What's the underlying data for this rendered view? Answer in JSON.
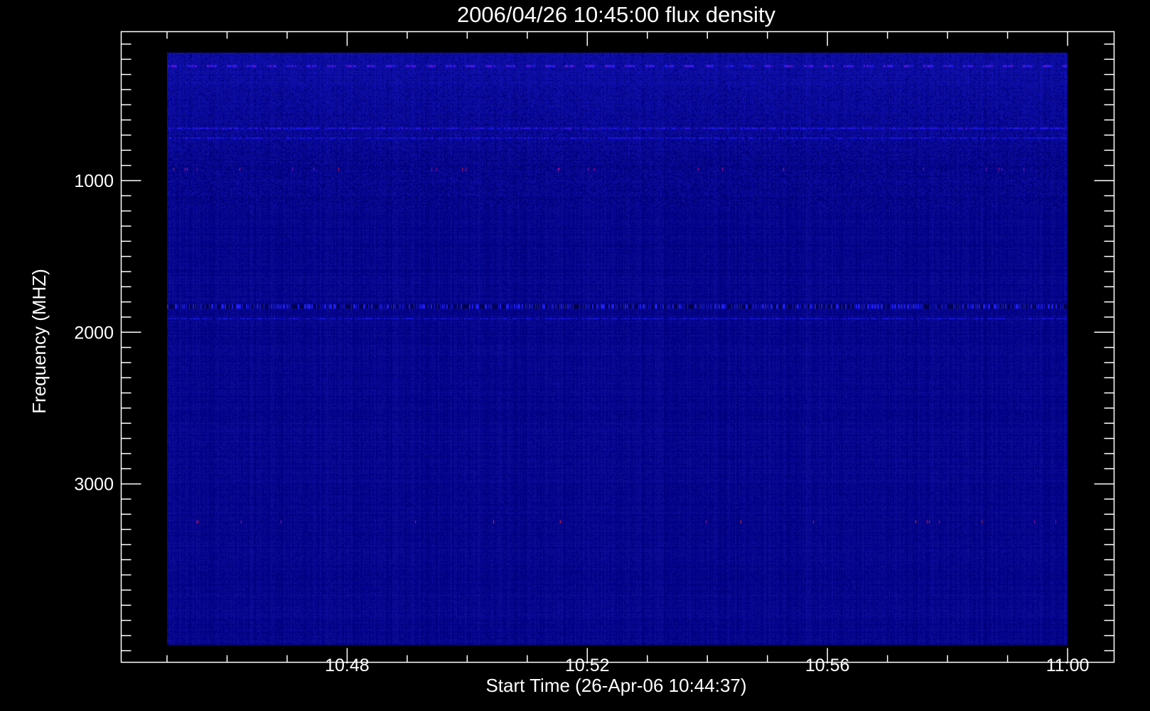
{
  "chart_data": {
    "type": "heatmap",
    "title": "2006/04/26 10:45:00 flux density",
    "xlabel": "Start Time (26-Apr-06 10:44:37)",
    "ylabel": "Frequency (MHZ)",
    "x_unit": "minutes after 10:45:00",
    "x_range": [
      0,
      15
    ],
    "x_major_ticks": [
      {
        "value": 3,
        "label": "10:48"
      },
      {
        "value": 7,
        "label": "10:52"
      },
      {
        "value": 11,
        "label": "10:56"
      },
      {
        "value": 15,
        "label": "11:00"
      }
    ],
    "x_minor_step": 1,
    "y_axis_range": [
      40,
      4180
    ],
    "y_data_range": [
      150,
      4070
    ],
    "y_inverted": true,
    "y_major_ticks": [
      {
        "value": 1000,
        "label": "1000"
      },
      {
        "value": 2000,
        "label": "2000"
      },
      {
        "value": 3000,
        "label": "3000"
      }
    ],
    "y_minor_step": 100,
    "colormap": [
      "#000000",
      "#0a0a8c",
      "#2020ff",
      "#8020c0",
      "#ff2020",
      "#ffa020"
    ],
    "background_level": 0.3,
    "features": [
      {
        "freq_mhz": 245,
        "kind": "dotted",
        "level": 0.6
      },
      {
        "freq_mhz": 655,
        "kind": "line",
        "level": 0.55
      },
      {
        "freq_mhz": 720,
        "kind": "line",
        "level": 0.5
      },
      {
        "freq_mhz": 925,
        "kind": "sparse-spikes",
        "level": 0.75
      },
      {
        "freq_mhz": 1830,
        "kind": "band",
        "level": 0.5
      },
      {
        "freq_mhz": 1910,
        "kind": "line",
        "level": 0.45
      },
      {
        "freq_mhz": 3250,
        "kind": "sparse-spikes",
        "level": 0.8
      }
    ]
  }
}
